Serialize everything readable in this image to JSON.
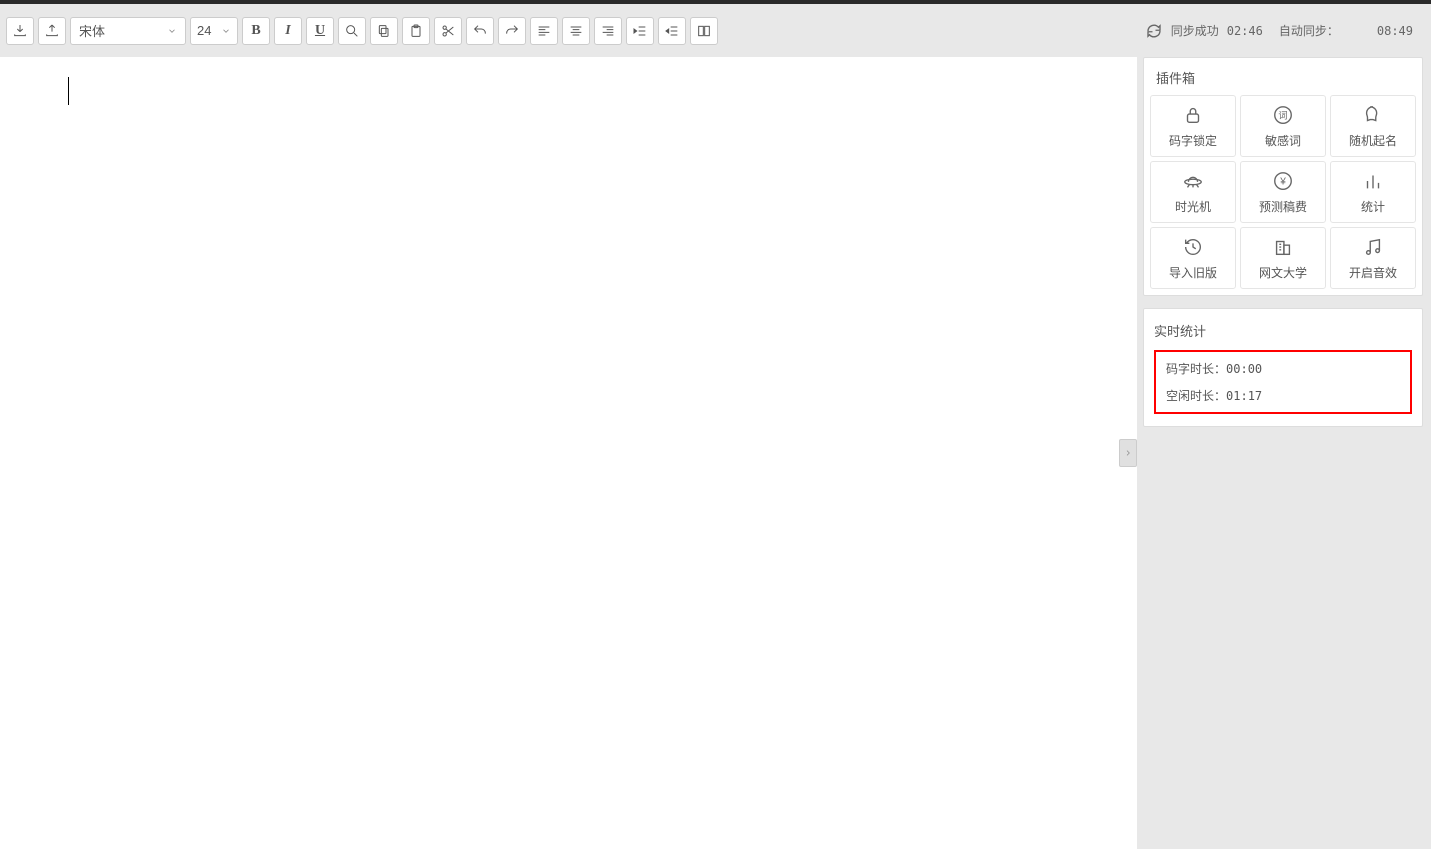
{
  "toolbar": {
    "font_name": "宋体",
    "font_size": "24",
    "bold": "B",
    "italic": "I",
    "underline": "U"
  },
  "sync": {
    "status_label": "同步成功",
    "status_time": "02:46",
    "auto_label": "自动同步：",
    "auto_time": "08:49"
  },
  "plugins": {
    "title": "插件箱",
    "items": [
      {
        "label": "码字锁定"
      },
      {
        "label": "敏感词"
      },
      {
        "label": "随机起名"
      },
      {
        "label": "时光机"
      },
      {
        "label": "预测稿费"
      },
      {
        "label": "统计"
      },
      {
        "label": "导入旧版"
      },
      {
        "label": "网文大学"
      },
      {
        "label": "开启音效"
      }
    ]
  },
  "stats": {
    "title": "实时统计",
    "typing_label": "码字时长：",
    "typing_value": "00:00",
    "idle_label": "空闲时长：",
    "idle_value": "01:17"
  }
}
